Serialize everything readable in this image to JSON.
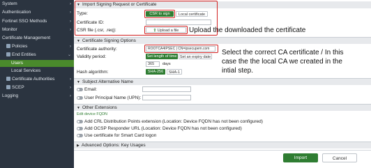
{
  "sidebar": {
    "items": [
      {
        "label": "System",
        "chevron": "›"
      },
      {
        "label": "Authentication",
        "chevron": "›"
      },
      {
        "label": "Fortinet SSO Methods",
        "chevron": "›"
      },
      {
        "label": "Monitor",
        "chevron": "›"
      },
      {
        "label": "Certificate Management"
      },
      {
        "label": "Policies",
        "chevron": "›"
      },
      {
        "label": "End Entities",
        "chevron": "⌄"
      },
      {
        "label": "Users"
      },
      {
        "label": "Local Services"
      },
      {
        "label": "Certificate Authorities",
        "chevron": "›"
      },
      {
        "label": "SCEP",
        "chevron": "›"
      },
      {
        "label": "Logging",
        "chevron": "›"
      }
    ]
  },
  "import_section": {
    "title": "Import Signing Request or Certificate",
    "type_label": "Type:",
    "csr_to_sign_label": "CSR to sign",
    "local_certificate_label": "Local certificate",
    "certificate_id_label": "Certificate ID:",
    "csr_file_label": "CSR file (.csr, .req):",
    "upload_file_label": "Upload a file"
  },
  "signing_options": {
    "title": "Certificate Signing Options",
    "ca_label": "Certificate authority:",
    "ca_value": "ROOTCA4IPSEC | CN=ipsecupem.com",
    "validity_label": "Validity period:",
    "set_length_label": "Set length of time",
    "set_expiry_label": "Set an expiry date",
    "days_value": "365",
    "days_unit": "days",
    "hash_label": "Hash algorithm:",
    "sha256_label": "SHA-256",
    "sha1_label": "SHA-1"
  },
  "san_section": {
    "title": "Subject Alternative Name",
    "email_label": "Email:",
    "upn_label": "User Principal Name (UPN):"
  },
  "extensions": {
    "title": "Other Extensions",
    "edit_link": "Edit device FQDN",
    "crl_label": "Add CRL Distribution Points extension (Location: Device FQDN has not been configured)",
    "ocsp_label": "Add OCSP Responder URL (Location: Device FQDN has not been configured)",
    "smartcard_label": "Use certificate for Smart Card logon"
  },
  "advanced": {
    "title": "Advanced Options: Key Usages"
  },
  "footer": {
    "import_label": "Import",
    "cancel_label": "Cancel"
  },
  "annotations": {
    "upload_note": "Upload the downloaded the certificate",
    "ca_note_1": "Select the correct CA certificate / In this",
    "ca_note_2": "case the the local CA we created in the",
    "ca_note_3": "intial step."
  },
  "colors": {
    "accent_green": "#2f7d32",
    "annotation_red": "#d11f1f",
    "sidebar_bg": "#2b3440"
  }
}
